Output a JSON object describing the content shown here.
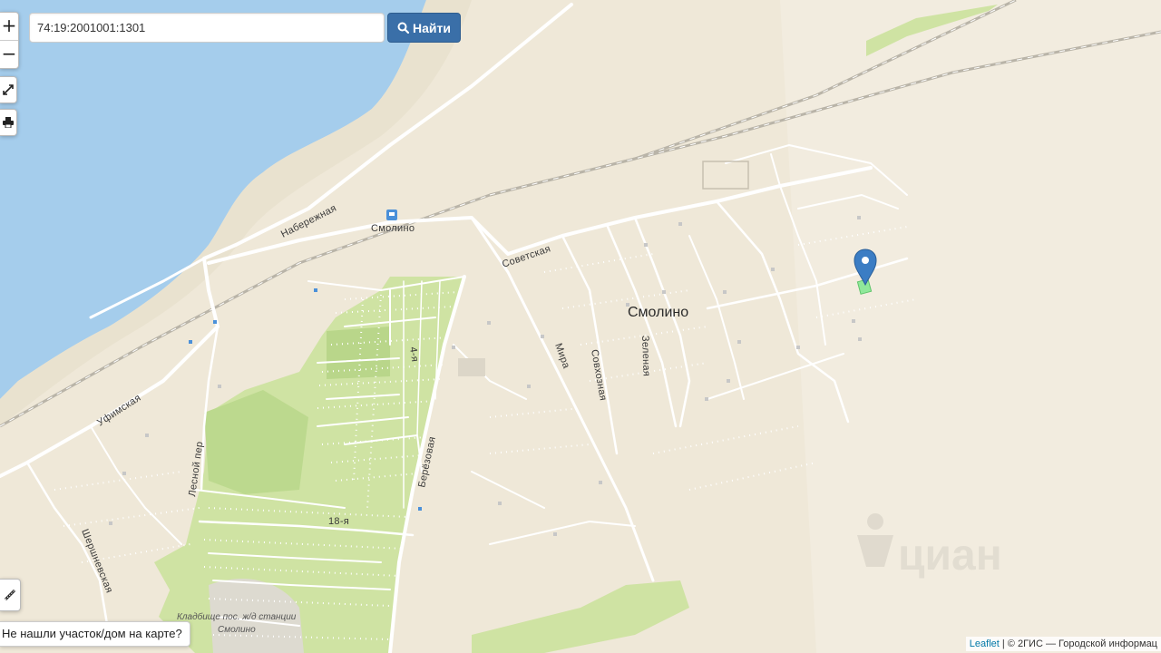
{
  "search": {
    "value": "74:19:2001001:1301",
    "button_label": "Найти",
    "button_icon": "search-icon"
  },
  "controls": {
    "zoom_in": "+",
    "zoom_out": "−",
    "fullscreen_icon": "expand-icon",
    "print_icon": "print-icon",
    "measure_icon": "ruler-icon"
  },
  "help_link": "Не нашли участок/дом на карте?",
  "attribution": {
    "leaflet": "Leaflet",
    "separator": " | ",
    "source": "© 2ГИС — Городской информац"
  },
  "map": {
    "settlement": "Смолино",
    "stop_label": "Смолино",
    "cemetery_line1": "Кладбище пос. ж/д станции",
    "cemetery_line2": "Смолино",
    "watermark": "циан",
    "streets": {
      "naberezhnaya": "Набережная",
      "sovetskaya": "Советская",
      "ufimskaya": "Уфимская",
      "lesnoy": "Лесной пер",
      "shershnevskaya": "Шершневская",
      "mira": "Мира",
      "sovkhoznaya": "Совхозная",
      "zelenaya": "Зеленая",
      "chetvertaya": "4-я",
      "berezovaya": "Берёзовая",
      "vosemnadtsataya": "18-я"
    },
    "colors": {
      "water": "#a5cdec",
      "land": "#efe8d8",
      "green": "#cfe3a3",
      "marker": "#3b7dc4",
      "parcel": "#8fe89a"
    }
  }
}
